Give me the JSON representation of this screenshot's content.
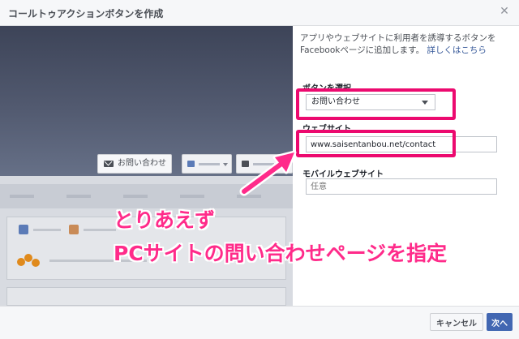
{
  "dialog": {
    "title": "コールトゥアクションボタンを作成"
  },
  "preview": {
    "cta_label": "お問い合わせ"
  },
  "panel": {
    "description": "アプリやウェブサイトに利用者を誘導するボタンをFacebookページに追加します。",
    "learn_more": "詳しくはこちら",
    "button_label": "ボタンを選択",
    "button_value": "お問い合わせ",
    "website_label": "ウェブサイト",
    "website_value": "www.saisentanbou.net/contact",
    "mobile_label": "モバイルウェブサイト",
    "mobile_placeholder": "任意"
  },
  "annotation": {
    "line1": "とりあえず",
    "line2": "PCサイトの問い合わせページを指定",
    "color": "#ff2b8a"
  },
  "footer": {
    "cancel_label": "キャンセル",
    "next_label": "次へ"
  },
  "colors": {
    "primary": "#4267b2",
    "highlight": "#ec0a6f"
  }
}
